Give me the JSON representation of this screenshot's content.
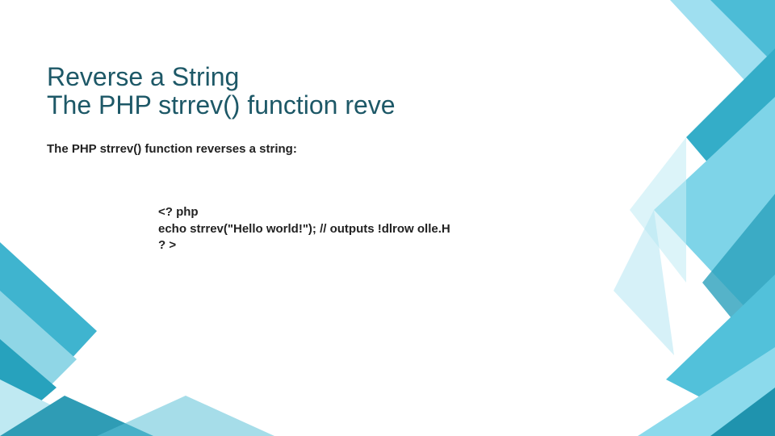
{
  "title_line1": "Reverse a String",
  "title_line2": "The PHP strrev() function reve",
  "subtitle": "The PHP strrev() function reverses a string:",
  "code_line1": "<? php",
  "code_line2": "echo strrev(\"Hello world!\"); // outputs !dlrow olle.H",
  "code_line3": "? >"
}
